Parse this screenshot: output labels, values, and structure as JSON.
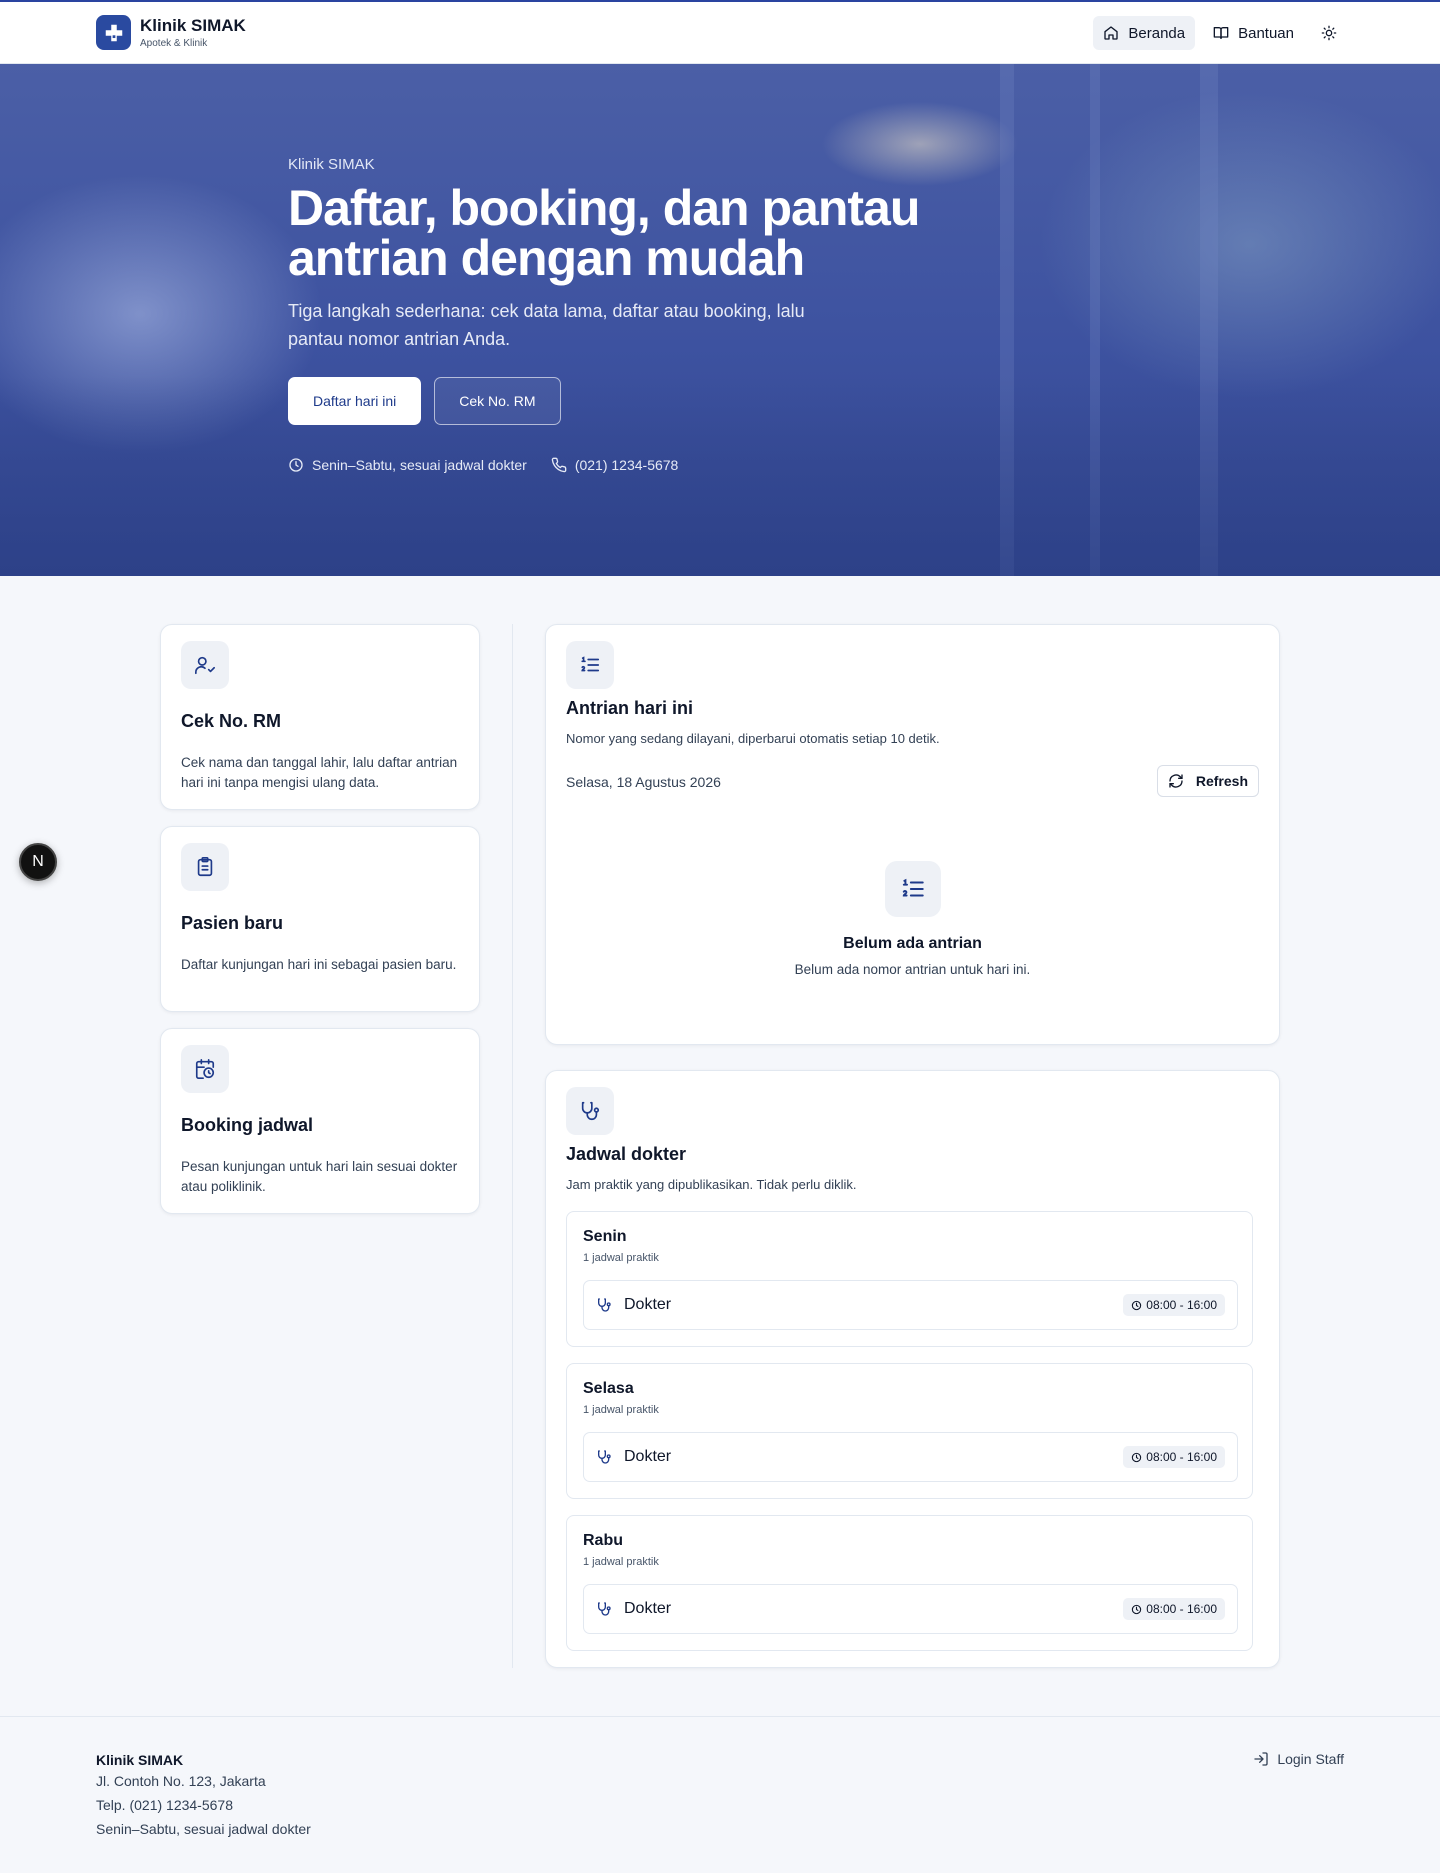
{
  "header": {
    "brand_name": "Klinik SIMAK",
    "brand_sub": "Apotek & Klinik",
    "nav": {
      "home": "Beranda",
      "help": "Bantuan"
    }
  },
  "hero": {
    "eyebrow": "Klinik SIMAK",
    "title": "Daftar, booking, dan pantau antrian dengan mudah",
    "subtitle": "Tiga langkah sederhana: cek data lama, daftar atau booking, lalu pantau nomor antrian Anda.",
    "primary_cta": "Daftar hari ini",
    "secondary_cta": "Cek No. RM",
    "hours": "Senin–Sabtu, sesuai jadwal dokter",
    "phone": "(021) 1234-5678"
  },
  "steps": [
    {
      "title": "Cek No. RM",
      "text": "Cek nama dan tanggal lahir, lalu daftar antrian hari ini tanpa mengisi ulang data.",
      "icon": "user-check-icon"
    },
    {
      "title": "Pasien baru",
      "text": "Daftar kunjungan hari ini sebagai pasien baru.",
      "icon": "clipboard-icon"
    },
    {
      "title": "Booking jadwal",
      "text": "Pesan kunjungan untuk hari lain sesuai dokter atau poliklinik.",
      "icon": "calendar-clock-icon"
    }
  ],
  "queue": {
    "title": "Antrian hari ini",
    "subtitle": "Nomor yang sedang dilayani, diperbarui otomatis setiap 10 detik.",
    "date": "Selasa, 18 Agustus 2026",
    "refresh_label": "Refresh",
    "empty_title": "Belum ada antrian",
    "empty_text": "Belum ada nomor antrian untuk hari ini."
  },
  "schedule": {
    "title": "Jadwal dokter",
    "subtitle": "Jam praktik yang dipublikasikan. Tidak perlu diklik.",
    "days": [
      {
        "day": "Senin",
        "count": "1 jadwal praktik",
        "doctor": "Dokter",
        "time": "08:00 - 16:00"
      },
      {
        "day": "Selasa",
        "count": "1 jadwal praktik",
        "doctor": "Dokter",
        "time": "08:00 - 16:00"
      },
      {
        "day": "Rabu",
        "count": "1 jadwal praktik",
        "doctor": "Dokter",
        "time": "08:00 - 16:00"
      }
    ]
  },
  "float_badge": "N",
  "footer": {
    "brand": "Klinik SIMAK",
    "address": "Jl. Contoh No. 123, Jakarta",
    "phone": "Telp. (021) 1234-5678",
    "hours": "Senin–Sabtu, sesuai jadwal dokter",
    "login": "Login Staff"
  },
  "colors": {
    "primary": "#2a4aa0",
    "hero_overlay": "#3d52a0",
    "page_bg": "#f5f7fb",
    "tile_bg": "#eef1f6"
  }
}
